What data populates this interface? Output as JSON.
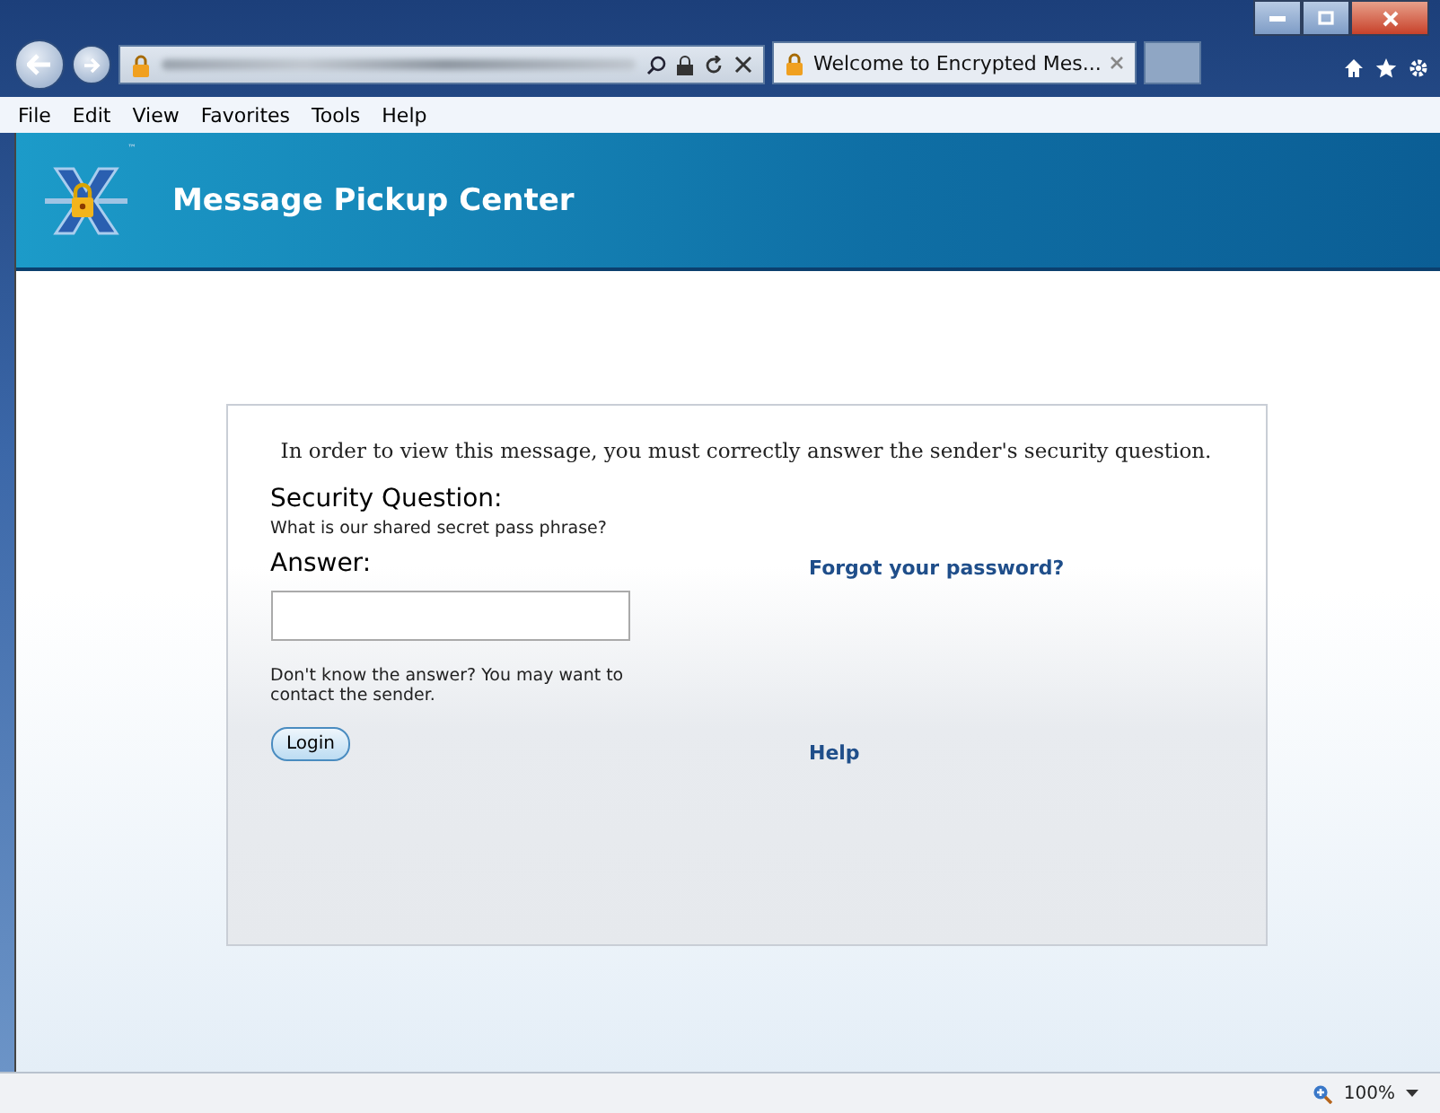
{
  "browser": {
    "tabs": [
      {
        "title": "Welcome to Encrypted Mes...",
        "selected": true
      }
    ],
    "menu": [
      "File",
      "Edit",
      "View",
      "Favorites",
      "Tools",
      "Help"
    ],
    "zoom": "100%"
  },
  "header": {
    "title": "Message Pickup Center",
    "trademark": "™"
  },
  "form": {
    "intro": "In order to view this message, you must correctly answer the sender's security question.",
    "question_label": "Security Question:",
    "question": "What is our shared secret pass phrase?",
    "answer_label": "Answer:",
    "hint": "Don't know the answer? You may want to contact the sender.",
    "login": "Login"
  },
  "links": [
    "Forgot your password?",
    "Help"
  ]
}
